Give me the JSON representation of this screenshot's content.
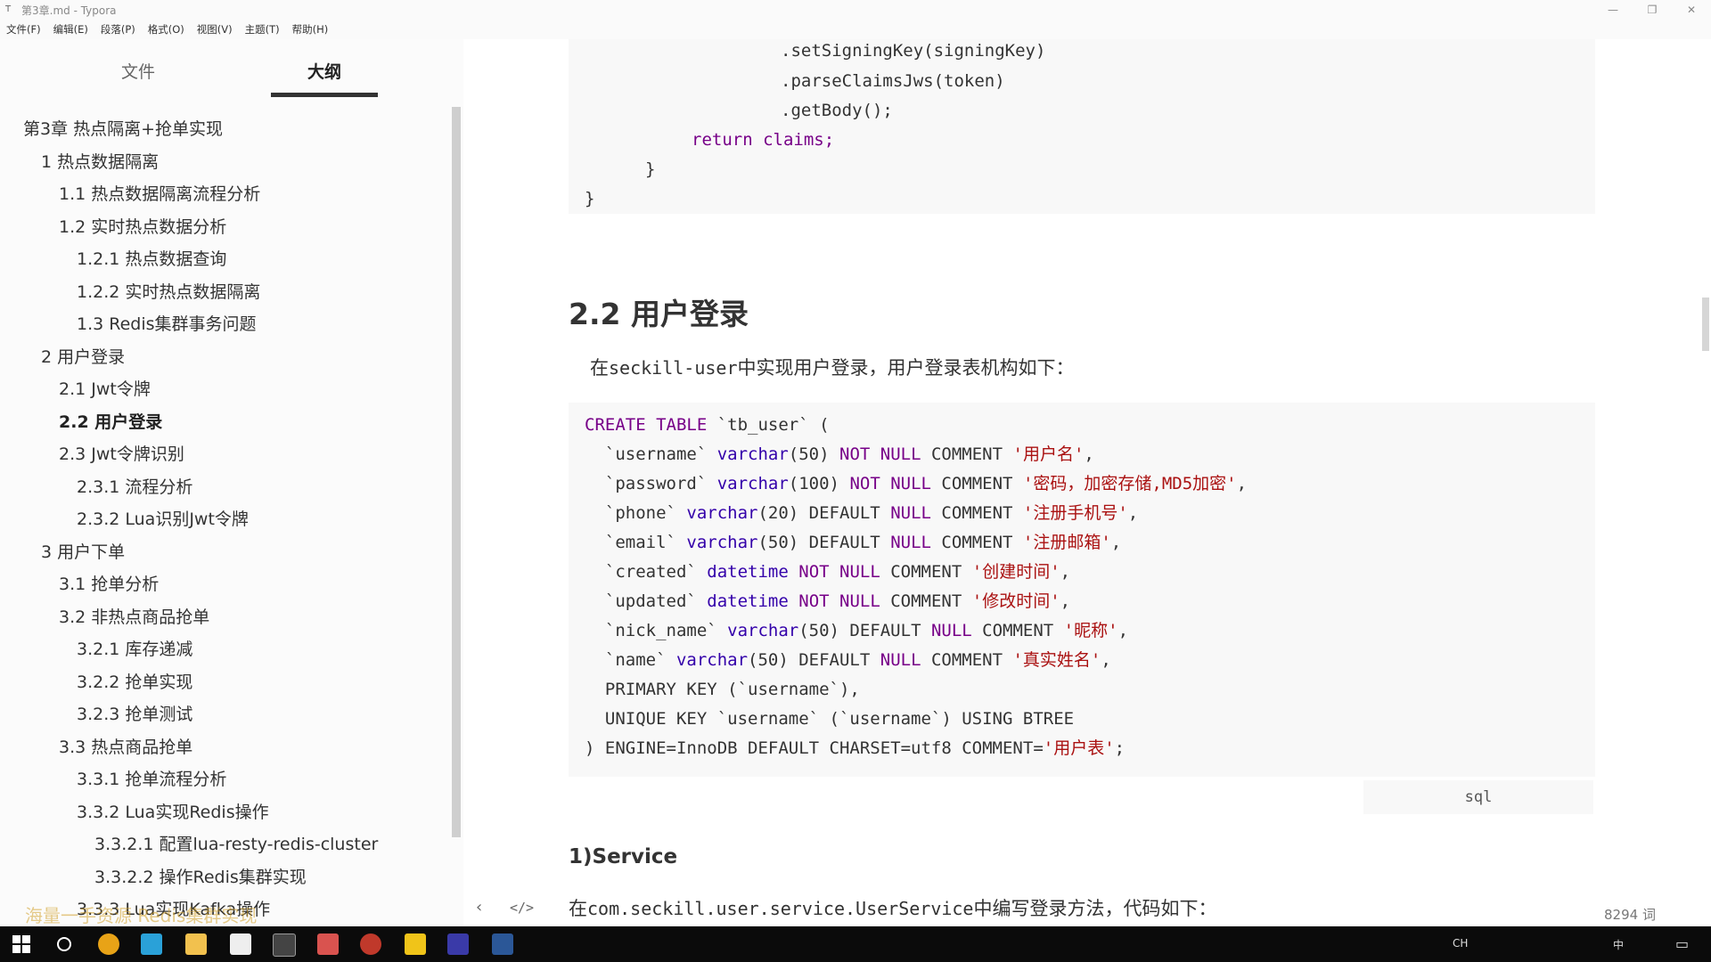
{
  "window": {
    "title": "第3章.md - Typora",
    "controls": [
      "—",
      "❐",
      "✕"
    ]
  },
  "menu": [
    "文件(F)",
    "编辑(E)",
    "段落(P)",
    "格式(O)",
    "视图(V)",
    "主题(T)",
    "帮助(H)"
  ],
  "sidebar": {
    "tabs": [
      "文件",
      "大纲"
    ],
    "active_tab": "大纲",
    "outline": [
      {
        "label": "第3章 热点隔离+抢单实现",
        "level": 0
      },
      {
        "label": "1 热点数据隔离",
        "level": 1
      },
      {
        "label": "1.1 热点数据隔离流程分析",
        "level": 2
      },
      {
        "label": "1.2 实时热点数据分析",
        "level": 2
      },
      {
        "label": "1.2.1 热点数据查询",
        "level": 3
      },
      {
        "label": "1.2.2 实时热点数据隔离",
        "level": 3
      },
      {
        "label": "1.3 Redis集群事务问题",
        "level": 3
      },
      {
        "label": "2 用户登录",
        "level": 1
      },
      {
        "label": "2.1 Jwt令牌",
        "level": 2
      },
      {
        "label": "2.2 用户登录",
        "level": 2,
        "active": true
      },
      {
        "label": "2.3 Jwt令牌识别",
        "level": 2
      },
      {
        "label": "2.3.1 流程分析",
        "level": 3
      },
      {
        "label": "2.3.2 Lua识别Jwt令牌",
        "level": 3
      },
      {
        "label": "3 用户下单",
        "level": 1
      },
      {
        "label": "3.1 抢单分析",
        "level": 2
      },
      {
        "label": "3.2 非热点商品抢单",
        "level": 2
      },
      {
        "label": "3.2.1 库存递减",
        "level": 3
      },
      {
        "label": "3.2.2 抢单实现",
        "level": 3
      },
      {
        "label": "3.2.3 抢单测试",
        "level": 3
      },
      {
        "label": "3.3 热点商品抢单",
        "level": 2
      },
      {
        "label": "3.3.1 抢单流程分析",
        "level": 3
      },
      {
        "label": "3.3.2 Lua实现Redis操作",
        "level": 3
      },
      {
        "label": "3.3.2.1 配置lua-resty-redis-cluster",
        "level": 4
      },
      {
        "label": "3.3.2.2 操作Redis集群实现",
        "level": 4
      },
      {
        "label": "3.3.3 Lua实现Kafka操作",
        "level": 3
      }
    ],
    "footer": {
      "prev": "‹",
      "source": "</>"
    }
  },
  "editor": {
    "code_top": [
      ".setSigningKey(signingKey)",
      ".parseClaimsJws(token)",
      ".getBody();",
      "return claims;",
      "}",
      "}"
    ],
    "heading": "2.2 用户登录",
    "intro_pre": "在",
    "intro_code": "seckill-user",
    "intro_post": "中实现用户登录，用户登录表机构如下：",
    "sql_lines": [
      "CREATE TABLE `tb_user` (",
      "  `username` varchar(50) NOT NULL COMMENT '用户名',",
      "  `password` varchar(100) NOT NULL COMMENT '密码，加密存储,MD5加密',",
      "  `phone` varchar(20) DEFAULT NULL COMMENT '注册手机号',",
      "  `email` varchar(50) DEFAULT NULL COMMENT '注册邮箱',",
      "  `created` datetime NOT NULL COMMENT '创建时间',",
      "  `updated` datetime NOT NULL COMMENT '修改时间',",
      "  `nick_name` varchar(50) DEFAULT NULL COMMENT '昵称',",
      "  `name` varchar(50) DEFAULT NULL COMMENT '真实姓名',",
      "  PRIMARY KEY (`username`),",
      "  UNIQUE KEY `username` (`username`) USING BTREE",
      ") ENGINE=InnoDB DEFAULT CHARSET=utf8 COMMENT='用户表';"
    ],
    "lang_tag": "sql",
    "subheading": "1)Service",
    "service_pre": "在",
    "service_code": "com.seckill.user.service.UserService",
    "service_post": "中编写登录方法，代码如下：",
    "word_count": "8294 词"
  },
  "watermark": "海量一手资源 Redis集群实现",
  "taskbar": {
    "tray_text": [
      "CH",
      "中"
    ],
    "colors": {
      "bg": "#0b0b0b"
    }
  }
}
